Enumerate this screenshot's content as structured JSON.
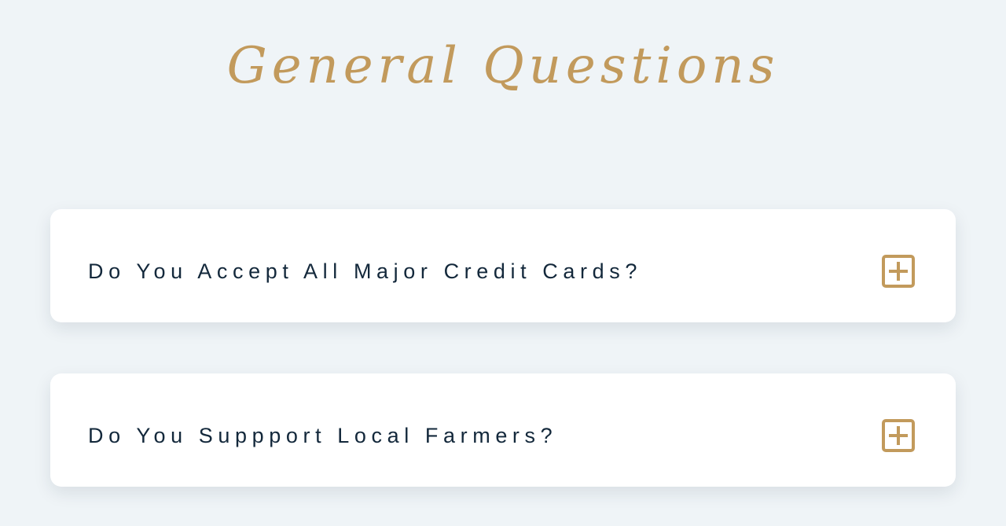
{
  "page": {
    "title": "General Questions"
  },
  "faq": {
    "items": [
      {
        "question": "Do You Accept All Major Credit Cards?",
        "icon": "plus-square-icon"
      },
      {
        "question": "Do You Suppport Local Farmers?",
        "icon": "plus-square-icon"
      }
    ]
  },
  "colors": {
    "background": "#eff4f7",
    "accent": "#c29a5c",
    "text": "#13283b",
    "card": "#ffffff"
  }
}
